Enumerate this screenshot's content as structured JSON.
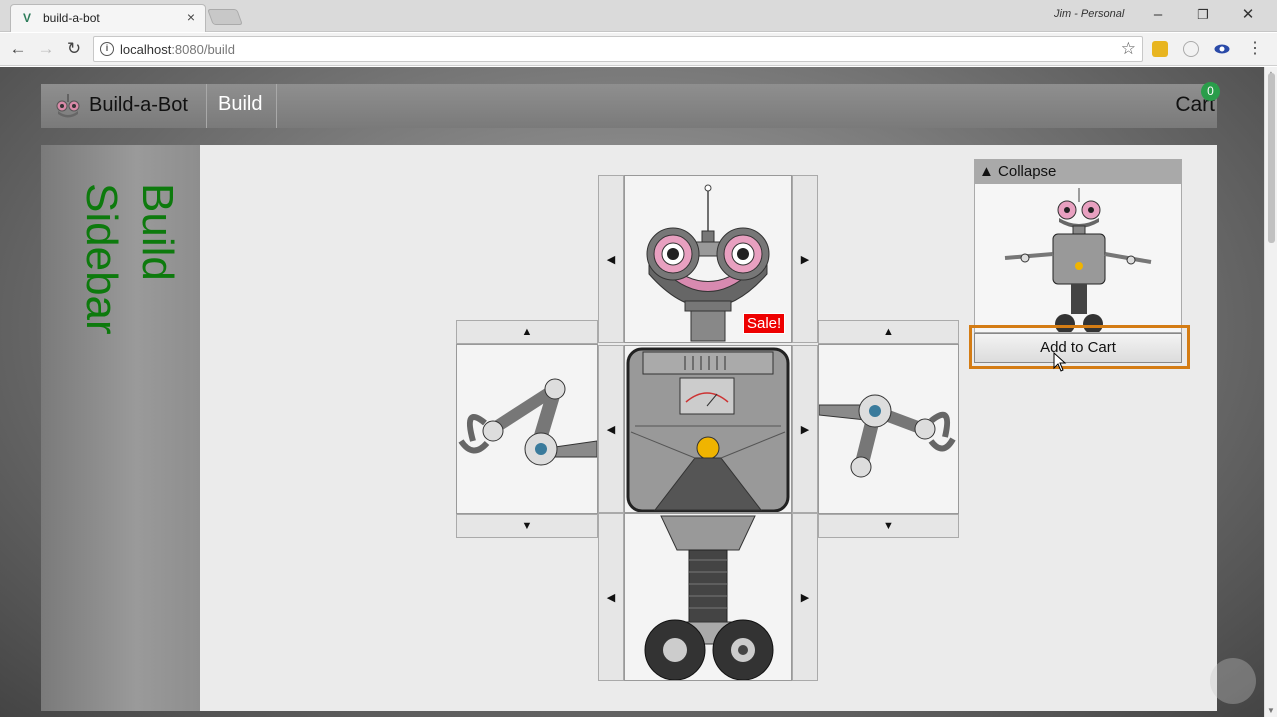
{
  "browser": {
    "tab_title": "build-a-bot",
    "tab_close": "×",
    "profile": "Jim - Personal",
    "url_host": "localhost",
    "url_rest": ":8080/build",
    "win_min": "–",
    "win_restore": "❐",
    "win_close": "✕",
    "back": "←",
    "forward": "→",
    "reload": "↻",
    "star": "☆"
  },
  "app": {
    "brand": "Build-a-Bot",
    "nav_build": "Build",
    "cart_label": "Cart",
    "cart_count": "0",
    "sidebar_text": "Build\nSidebar"
  },
  "builder": {
    "sale_label": "Sale!",
    "arrow_left": "◀",
    "arrow_right": "▶",
    "arrow_up": "▲",
    "arrow_down": "▼"
  },
  "preview": {
    "collapse_label": "▲ Collapse",
    "add_to_cart": "Add to Cart"
  },
  "colors": {
    "sidebar_text": "#0d7a0d",
    "cart_badge": "#2a9d4a",
    "sale": "#ee0000",
    "highlight": "#d47c14"
  }
}
